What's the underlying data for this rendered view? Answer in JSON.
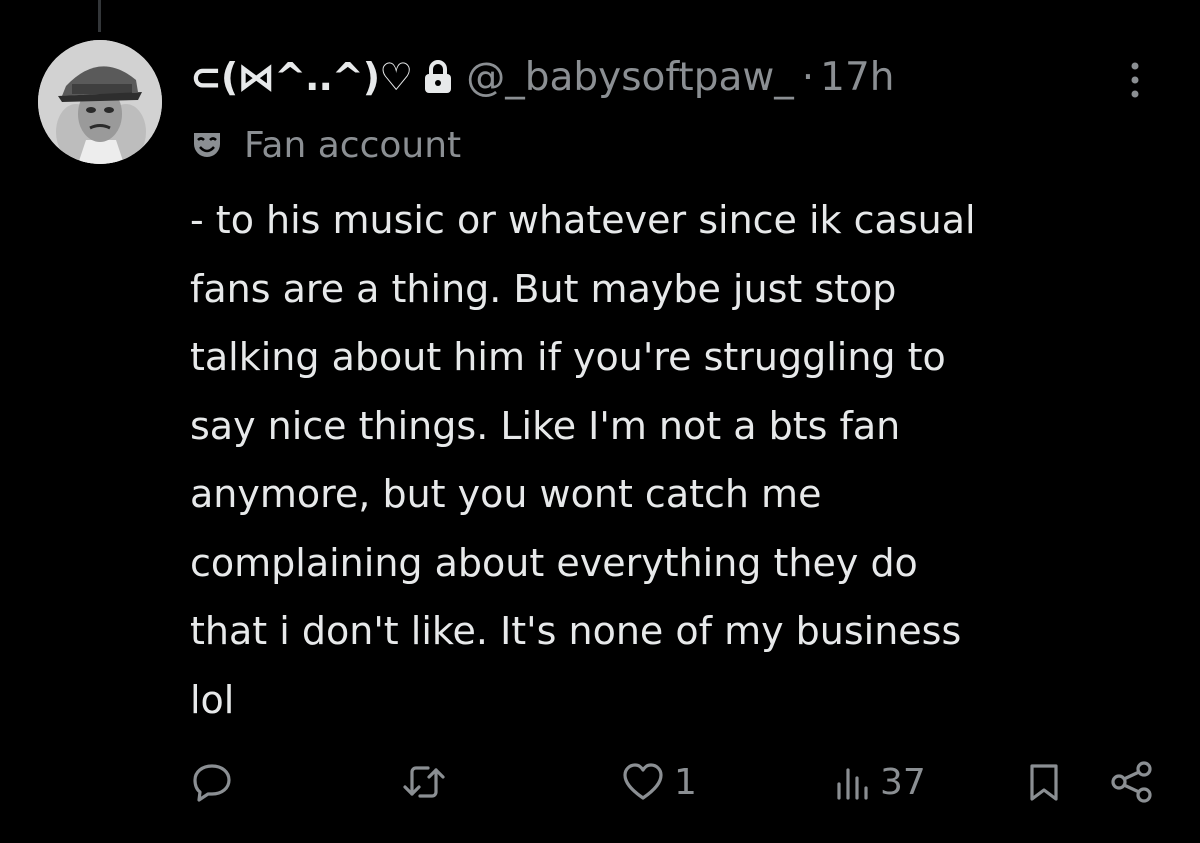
{
  "tweet": {
    "author": {
      "display_name": "⊂(⋈^..^)♡",
      "handle": "@_babysoftpaw_",
      "separator": "·",
      "time": "17h",
      "label": "Fan account"
    },
    "text": "- to his music or whatever since ik casual\nfans are a thing. But maybe just stop\ntalking about him if you're struggling to\nsay nice things. Like I'm not a bts fan\nanymore, but you wont catch me\ncomplaining about everything they do\nthat i don't like. It's none of my business\nlol",
    "stats": {
      "replies": "",
      "reposts": "",
      "likes": "1",
      "views": "37"
    }
  },
  "icons": {
    "lock": "lock-icon",
    "more": "more-icon",
    "label": "mask-icon",
    "reply": "reply-icon",
    "repost": "repost-icon",
    "like": "heart-icon",
    "views": "views-icon",
    "bookmark": "bookmark-icon",
    "share": "share-icon"
  },
  "colors": {
    "background": "#000000",
    "text_primary": "#e7e9ea",
    "text_secondary": "#8b8f93"
  }
}
